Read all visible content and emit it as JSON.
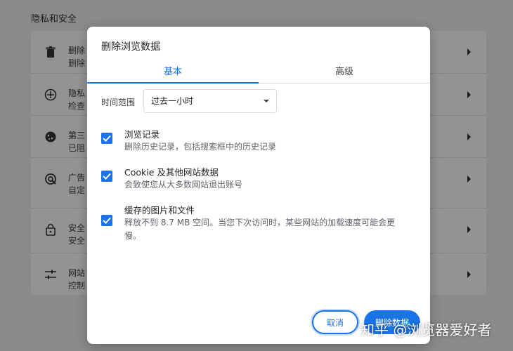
{
  "background": {
    "section_title": "隐私和安全",
    "rows": [
      {
        "icon": "trash-icon",
        "line1": "删除",
        "line2": "删除"
      },
      {
        "icon": "privacy-guide-icon",
        "line1": "隐私",
        "line2": "检查"
      },
      {
        "icon": "cookie-icon",
        "line1": "第三",
        "line2": "已阻"
      },
      {
        "icon": "ad-privacy-icon",
        "line1": "广告",
        "line2": "自定"
      },
      {
        "icon": "lock-icon",
        "line1": "安全",
        "line2": "安全"
      },
      {
        "icon": "sliders-icon",
        "line1": "网站",
        "line2": "控制"
      }
    ]
  },
  "dialog": {
    "title": "删除浏览数据",
    "tabs": [
      {
        "label": "基本",
        "selected": true
      },
      {
        "label": "高级",
        "selected": false
      }
    ],
    "time_range": {
      "label": "时间范围",
      "value": "过去一小时"
    },
    "options": [
      {
        "title": "浏览记录",
        "desc": "删除历史记录，包括搜索框中的历史记录",
        "checked": true
      },
      {
        "title": "Cookie 及其他网站数据",
        "desc": "会致使您从大多数网站退出账号",
        "checked": true
      },
      {
        "title": "缓存的图片和文件",
        "desc": "释放不到 8.7 MB 空间。当您下次访问时，某些网站的加载速度可能会更慢。",
        "checked": true
      }
    ],
    "buttons": {
      "cancel": "取消",
      "delete": "删除数据"
    }
  },
  "watermark": "知乎 @浏览器爱好者",
  "colors": {
    "accent": "#1a73e8",
    "overlay": "#8a8a8a"
  }
}
